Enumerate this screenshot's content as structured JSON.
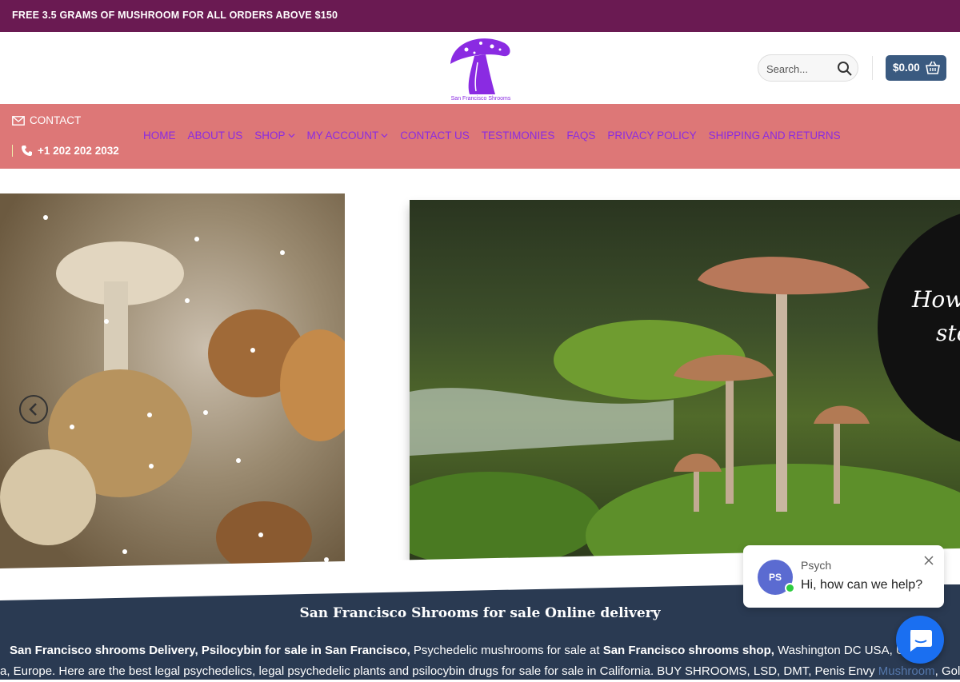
{
  "promo": {
    "text": "FREE 3.5 GRAMS OF MUSHROOM FOR ALL ORDERS ABOVE $150"
  },
  "header": {
    "logo_text": "San Francisco Shrooms",
    "search_placeholder": "Search...",
    "cart_total": "$0.00"
  },
  "nav": {
    "contact_label": "CONTACT",
    "phone": "+1 202 202 2032",
    "items": [
      {
        "label": "HOME",
        "dropdown": false
      },
      {
        "label": "ABOUT US",
        "dropdown": false
      },
      {
        "label": "SHOP",
        "dropdown": true
      },
      {
        "label": "MY ACCOUNT",
        "dropdown": true
      },
      {
        "label": "CONTACT US",
        "dropdown": false
      },
      {
        "label": "TESTIMONIES",
        "dropdown": false
      },
      {
        "label": "FAQS",
        "dropdown": false
      },
      {
        "label": "PRIVACY POLICY",
        "dropdown": false
      },
      {
        "label": "SHIPPING AND RETURNS",
        "dropdown": false
      }
    ]
  },
  "slider": {
    "overlay_line1": "How",
    "overlay_line2": "sto",
    "active_dot": 0,
    "dot_count": 3
  },
  "content": {
    "heading": "San Francisco Shrooms for sale Online delivery",
    "p_bold1": "San Francisco shrooms Delivery, Psilocybin for sale in San Francisco,",
    "p_text1": " Psychedelic mushrooms for sale at ",
    "p_bold2": "San Francisco shrooms shop,",
    "p_text2": " Washington DC USA, UK, ",
    "p_text3": "a, Europe. Here are the best legal psychedelics, legal psychedelic plants and psilocybin drugs for sale for sale in California. BUY SHROOMS, LSD, DMT, Penis Envy ",
    "p_link": "Mushroom",
    "p_text4": ", Gold"
  },
  "chat": {
    "avatar_initials": "PS",
    "agent_name": "Psych",
    "message": "Hi, how can we help?"
  },
  "colors": {
    "topbar": "#6a1a52",
    "navbar": "#dd7777",
    "menu_text": "#8a2be2",
    "cart": "#3a5a80",
    "content_bg": "#2a3a52",
    "chat_button": "#1a6ff1"
  }
}
